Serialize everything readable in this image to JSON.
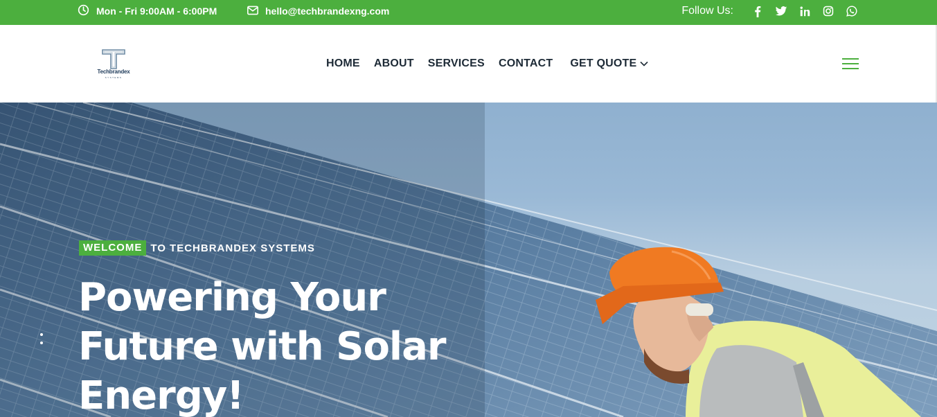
{
  "topbar": {
    "hours": "Mon - Fri 9:00AM - 6:00PM",
    "email": "hello@techbrandexng.com",
    "follow_label": "Follow Us:",
    "social_icons": [
      "facebook-icon",
      "twitter-icon",
      "linkedin-icon",
      "instagram-icon",
      "whatsapp-icon"
    ],
    "background_color": "#4caf3e"
  },
  "header": {
    "logo": {
      "mark": "T",
      "name": "Techbrandex",
      "tagline": "SYSTEMS"
    },
    "nav": [
      "HOME",
      "ABOUT",
      "SERVICES",
      "CONTACT"
    ],
    "quote_label": "GET QUOTE",
    "menu_icon": "hamburger-icon",
    "accent_color": "#4caf3e"
  },
  "hero": {
    "welcome_badge": "WELCOME",
    "welcome_rest": "TO TECHBRANDEX SYSTEMS",
    "title_line1": "Powering Your",
    "title_line2": "Future with Solar",
    "title_line3": "Energy!"
  }
}
